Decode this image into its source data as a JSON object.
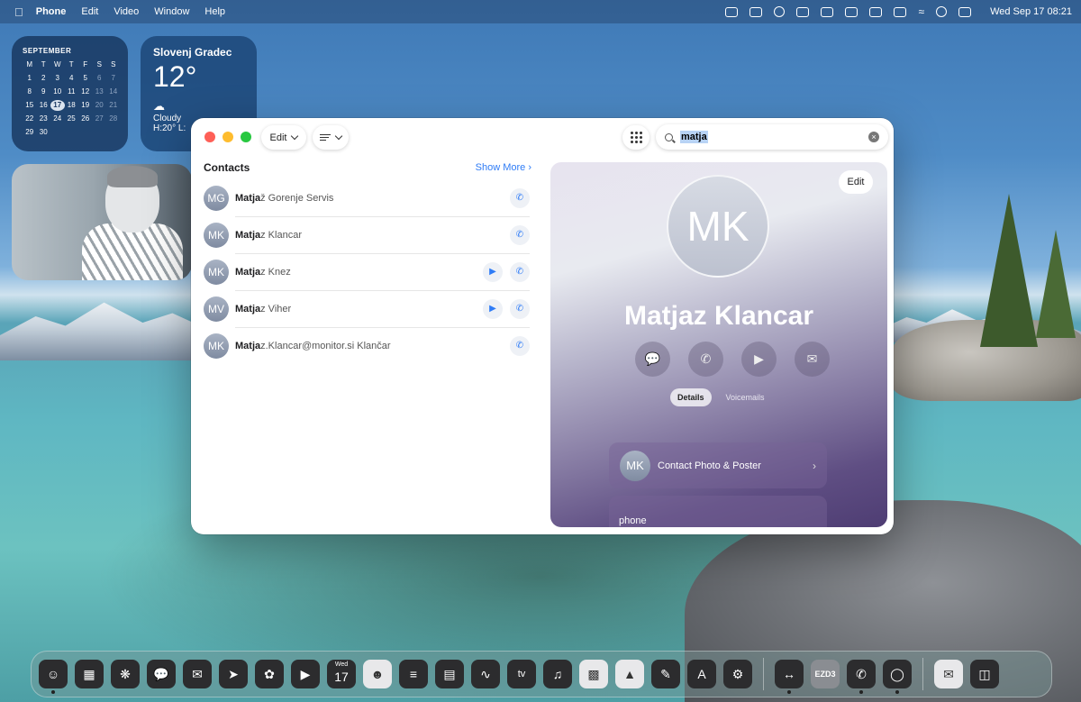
{
  "menubar": {
    "apple": "",
    "app": "Phone",
    "items": [
      "Edit",
      "Video",
      "Window",
      "Help"
    ],
    "clock": "Wed Sep 17  08:21"
  },
  "calendar": {
    "month": "SEPTEMBER",
    "weekdays": [
      "M",
      "T",
      "W",
      "T",
      "F",
      "S",
      "S"
    ],
    "days": [
      "1",
      "2",
      "3",
      "4",
      "5",
      "6",
      "7",
      "8",
      "9",
      "10",
      "11",
      "12",
      "13",
      "14",
      "15",
      "16",
      "17",
      "18",
      "19",
      "20",
      "21",
      "22",
      "23",
      "24",
      "25",
      "26",
      "27",
      "28",
      "29",
      "30"
    ],
    "today": "17"
  },
  "weather": {
    "city": "Slovenj Gradec",
    "temp": "12°",
    "condition": "Cloudy",
    "hilo": "H:20° L:"
  },
  "window": {
    "edit_label": "Edit",
    "search_value": "matja",
    "contacts_title": "Contacts",
    "show_more": "Show More"
  },
  "contacts": [
    {
      "initials": "MG",
      "match": "Matja",
      "rest": "ž Gorenje Servis",
      "video": false
    },
    {
      "initials": "MK",
      "match": "Matja",
      "rest": "z Klancar",
      "video": false
    },
    {
      "initials": "MK",
      "match": "Matja",
      "rest": "z Knez",
      "video": true
    },
    {
      "initials": "MV",
      "match": "Matja",
      "rest": "z Viher",
      "video": true
    },
    {
      "initials": "MK",
      "match": "Matja",
      "rest": "z.Klancar@monitor.si Klančar",
      "video": false
    }
  ],
  "detail": {
    "edit": "Edit",
    "initials": "MK",
    "name": "Matjaz Klancar",
    "tabs": [
      "Details",
      "Voicemails"
    ],
    "photo_card": {
      "initials": "MK",
      "label": "Contact Photo & Poster"
    },
    "phone_label": "phone"
  },
  "dock": [
    "Finder",
    "Launchpad",
    "Safari",
    "Messages",
    "Mail",
    "Maps",
    "Photos",
    "FaceTime",
    "Calendar",
    "Contacts",
    "Reminders",
    "Notes",
    "Freeform",
    "TV",
    "Music",
    "Numbers",
    "Keynote",
    "Pages",
    "App Store",
    "System Settings",
    "TeamViewer",
    "EZD3",
    "Phone",
    "Chrome",
    "Document",
    "Trash"
  ],
  "dock_calendar": {
    "day": "Wed",
    "date": "17"
  },
  "dock_ezd": "EZD3",
  "dock_tv": "tv"
}
